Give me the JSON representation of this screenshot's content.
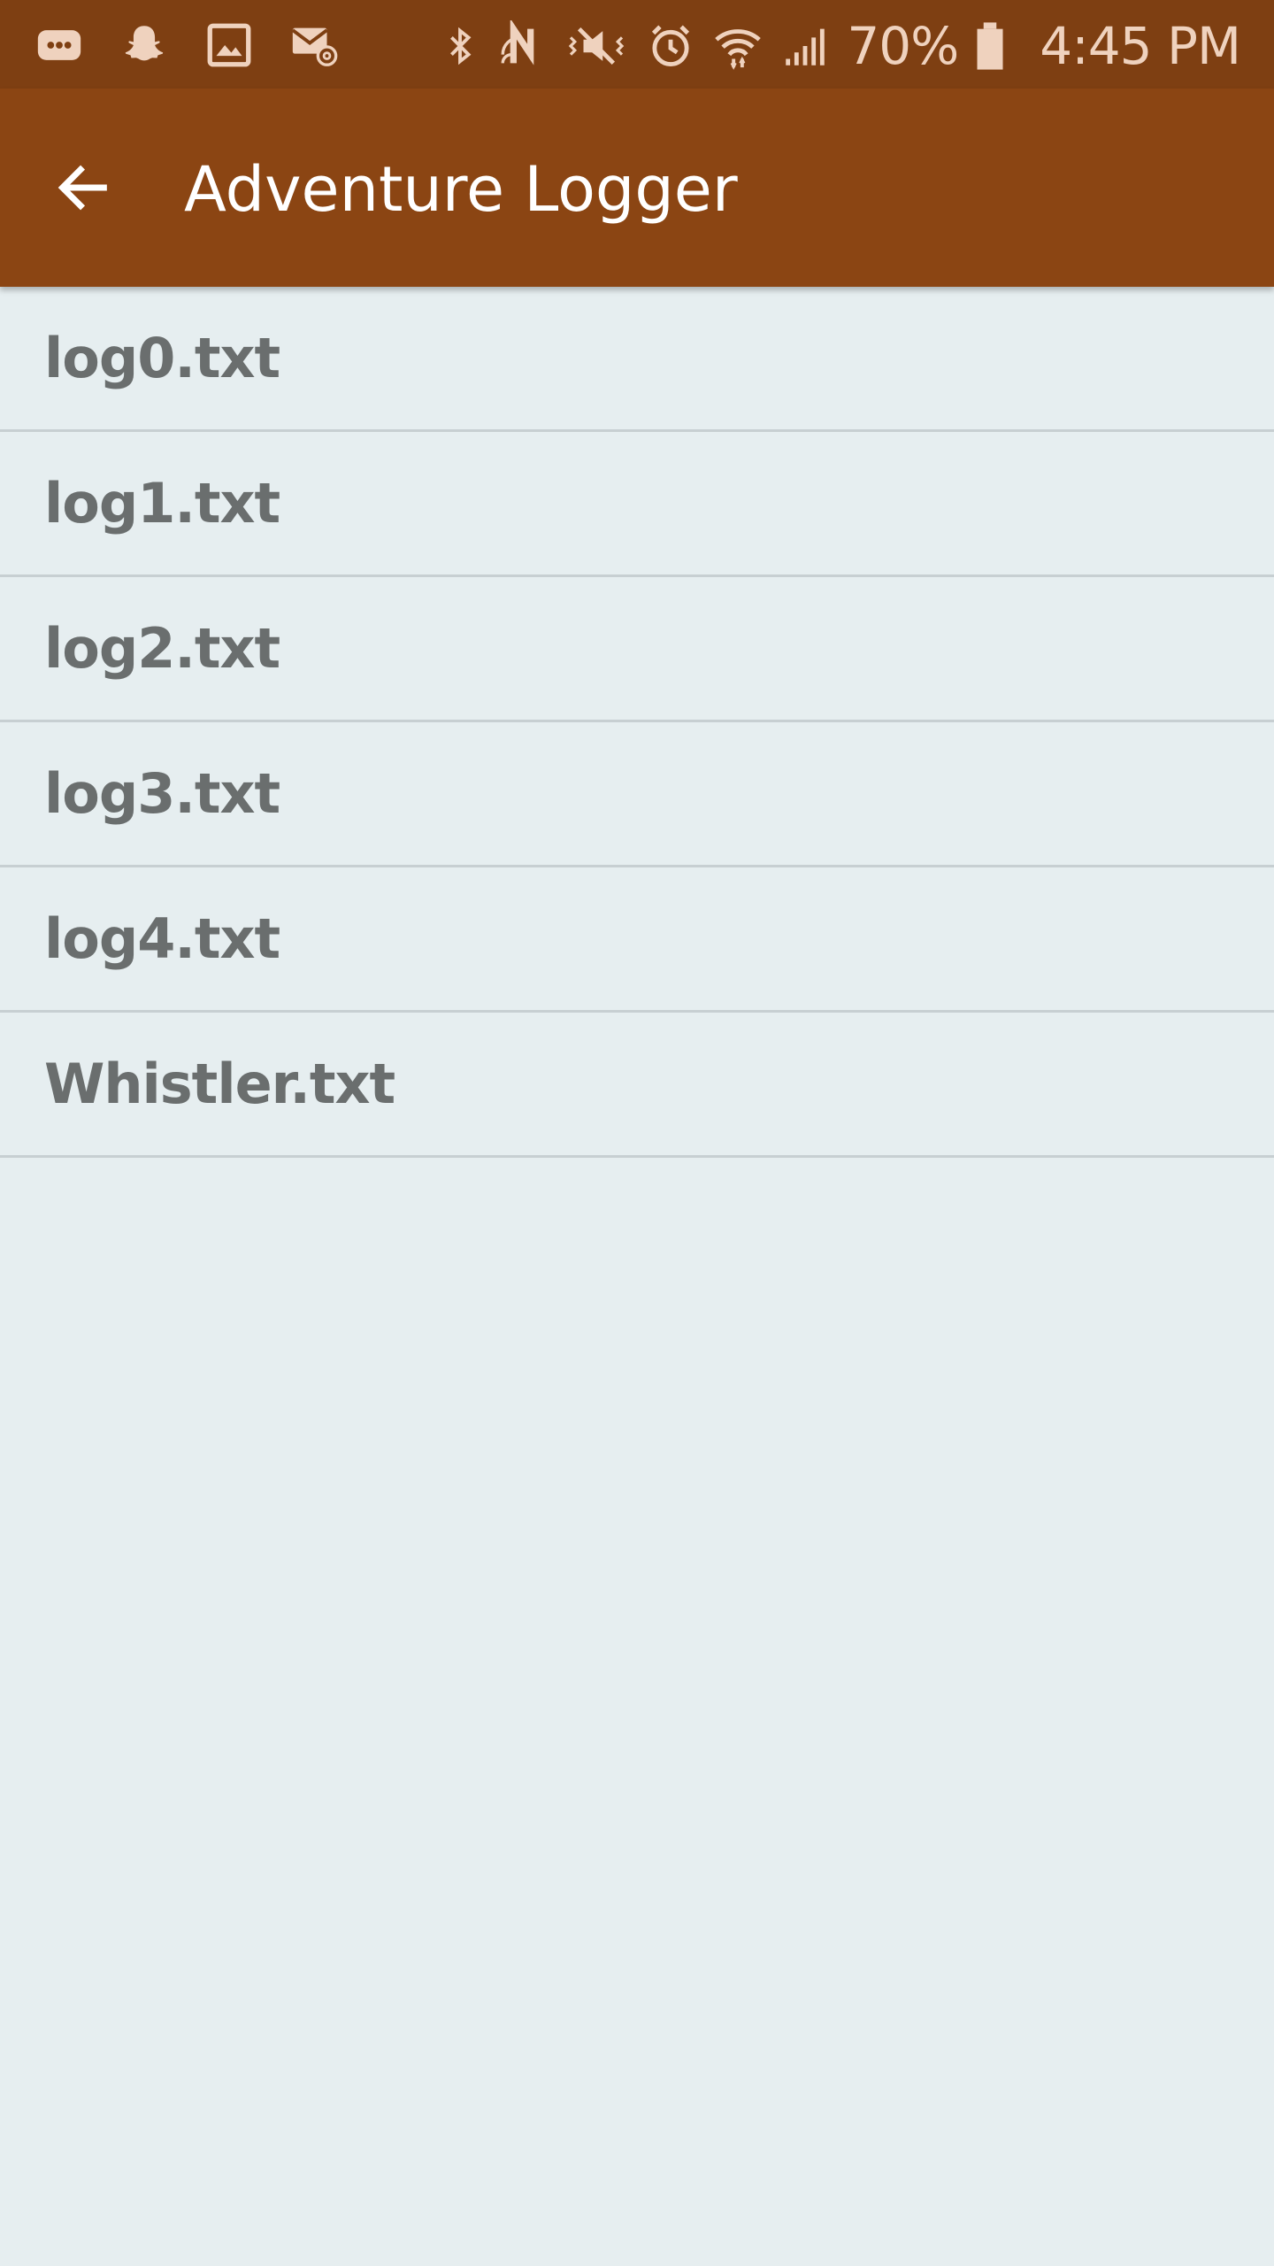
{
  "status_bar": {
    "left_icons": [
      "message-icon",
      "snapchat-icon",
      "gallery-icon",
      "email-icon"
    ],
    "right_icons": [
      "bluetooth-icon",
      "nfc-icon",
      "mute-icon",
      "alarm-icon",
      "wifi-icon",
      "signal-icon"
    ],
    "battery_percent": "70%",
    "time": "4:45 PM"
  },
  "app_bar": {
    "title": "Adventure Logger",
    "back_icon": "arrow-back-icon",
    "background_color": "#8b4513"
  },
  "files": [
    {
      "name": "log0.txt"
    },
    {
      "name": "log1.txt"
    },
    {
      "name": "log2.txt"
    },
    {
      "name": "log3.txt"
    },
    {
      "name": "log4.txt"
    },
    {
      "name": "Whistler.txt"
    }
  ]
}
